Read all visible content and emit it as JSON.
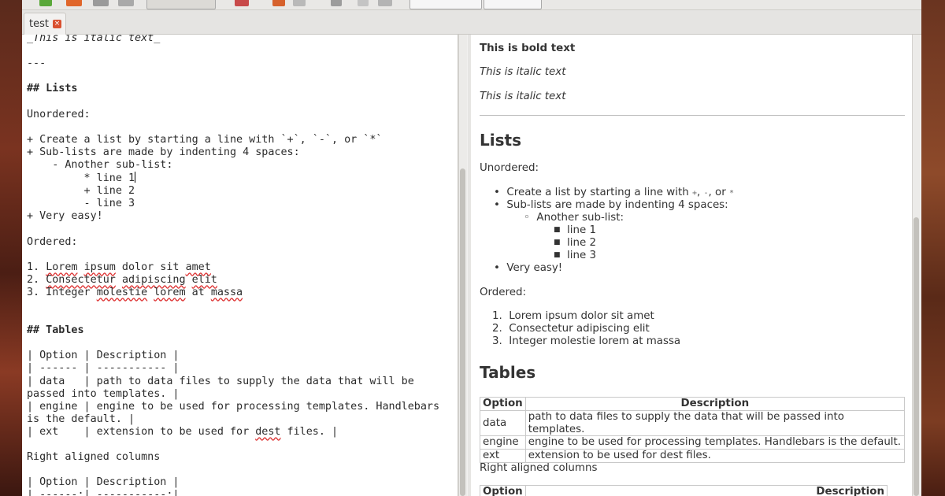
{
  "tab": {
    "label": "test",
    "close": "×"
  },
  "editor": {
    "l1": "_This is italic text_",
    "l2": "---",
    "l3": "## Lists",
    "l4": "Unordered:",
    "l5": "+ Create a list by starting a line with `+`, `-`, or `*`",
    "l6": "+ Sub-lists are made by indenting 4 spaces:",
    "l7": "    - Another sub-list:",
    "l8": "         * line 1",
    "l9": "         + line 2",
    "l10": "         - line 3",
    "l11": "+ Very easy!",
    "l12": "Ordered:",
    "l13a": "1. ",
    "l13b": "Lorem",
    "l13c": " ",
    "l13d": "ipsum",
    "l13e": " dolor sit ",
    "l13f": "amet",
    "l14a": "2. ",
    "l14b": "Consectetur",
    "l14c": " ",
    "l14d": "adipiscing",
    "l14e": " ",
    "l14f": "elit",
    "l15a": "3. Integer ",
    "l15b": "molestie",
    "l15c": " ",
    "l15d": "lorem",
    "l15e": " at ",
    "l15f": "massa",
    "l16": "## Tables",
    "l17": "| Option | Description |",
    "l18": "| ------ | ----------- |",
    "l19": "| data   | path to data files to supply the data that will be",
    "l20": "passed into templates. |",
    "l21": "| engine | engine to be used for processing templates. Handlebars",
    "l22": "is the default. |",
    "l23a": "| ext    | extension to be used for ",
    "l23b": "dest",
    "l23c": " files. |",
    "l24": "Right aligned columns",
    "l25": "| Option | Description |",
    "l26": "| ------:| -----------:|"
  },
  "preview": {
    "bold": "This is bold text",
    "italic1": "This is italic text",
    "italic2": "This is italic text",
    "lists_heading": "Lists",
    "unordered_label": "Unordered:",
    "ul1_pre": "Create a list by starting a line with ",
    "ul1_c1": "+",
    "ul1_sep1": ", ",
    "ul1_c2": "-",
    "ul1_sep2": ", or ",
    "ul1_c3": "*",
    "ul2": "Sub-lists are made by indenting 4 spaces:",
    "ul2_sub": "Another sub-list:",
    "ul2_sub_items": [
      "line 1",
      "line 2",
      "line 3"
    ],
    "ul3": "Very easy!",
    "ordered_label": "Ordered:",
    "ol": [
      "Lorem ipsum dolor sit amet",
      "Consectetur adipiscing elit",
      "Integer molestie lorem at massa"
    ],
    "tables_heading": "Tables",
    "table": {
      "headers": [
        "Option",
        "Description"
      ],
      "rows": [
        [
          "data",
          "path to data files to supply the data that will be passed into templates."
        ],
        [
          "engine",
          "engine to be used for processing templates. Handlebars is the default."
        ],
        [
          "ext",
          "extension to be used for dest files."
        ]
      ]
    },
    "right_aligned_label": "Right aligned columns",
    "table2_headers": [
      "Option",
      "Description"
    ]
  }
}
